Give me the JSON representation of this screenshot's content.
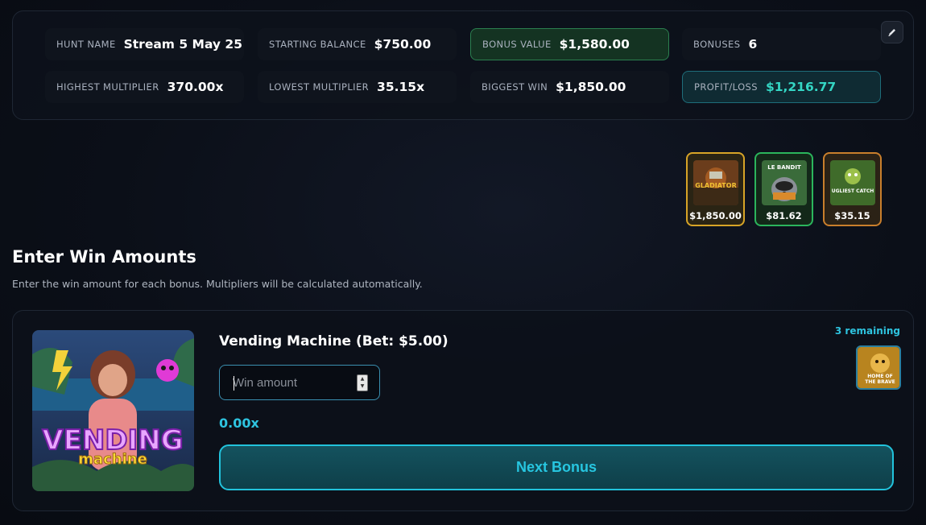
{
  "stats": {
    "hunt_name": {
      "label": "HUNT NAME",
      "value": "Stream 5 May 25"
    },
    "starting_balance": {
      "label": "STARTING BALANCE",
      "value": "$750.00"
    },
    "bonus_value": {
      "label": "BONUS VALUE",
      "value": "$1,580.00"
    },
    "bonuses": {
      "label": "BONUSES",
      "value": "6"
    },
    "highest_multiplier": {
      "label": "HIGHEST MULTIPLIER",
      "value": "370.00x"
    },
    "lowest_multiplier": {
      "label": "LOWEST MULTIPLIER",
      "value": "35.15x"
    },
    "biggest_win": {
      "label": "BIGGEST WIN",
      "value": "$1,850.00"
    },
    "profit_loss": {
      "label": "PROFIT/LOSS",
      "value": "$1,216.77"
    }
  },
  "edit_icon": "pencil-icon",
  "top_wins": [
    {
      "amount": "$1,850.00",
      "art_text": "GLADIATOR",
      "border": "#d7a427"
    },
    {
      "amount": "$81.62",
      "art_text": "LE BANDIT",
      "border": "#2bb55c"
    },
    {
      "amount": "$35.15",
      "art_text": "UGLIEST CATCH",
      "border": "#c97f2c"
    }
  ],
  "section": {
    "title": "Enter Win Amounts",
    "description": "Enter the win amount for each bonus. Multipliers will be calculated automatically."
  },
  "current_bonus": {
    "title": "Vending Machine (Bet: $5.00)",
    "art_text_1": "VENDING",
    "art_text_2": "machine",
    "input_placeholder": "Win amount",
    "multiplier": "0.00x",
    "next_label": "Next Bonus",
    "remaining": "3 remaining",
    "next_queue_art_text_1": "HOME OF",
    "next_queue_art_text_2": "THE BRAVE"
  },
  "colors": {
    "accent": "#2ec4e0",
    "profit": "#34d6c4",
    "bonus_value_bg": "#143322"
  }
}
